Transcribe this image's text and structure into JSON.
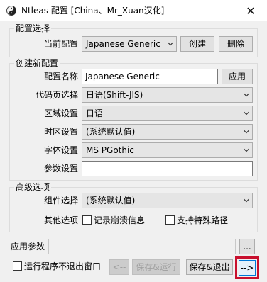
{
  "window": {
    "title": "Ntleas 配置 [China、Mr_Xuan汉化]",
    "close_glyph": "✕"
  },
  "config_select": {
    "group_label": "配置选择",
    "current_label": "当前配置",
    "current_value": "Japanese Generic",
    "create_button": "创建",
    "delete_button": "删除"
  },
  "create_config": {
    "group_label": "创建新配置",
    "name_label": "配置名称",
    "name_value": "Japanese Generic",
    "apply_button": "应用",
    "codepage_label": "代码页选择",
    "codepage_value": "日语(Shift-JIS)",
    "region_label": "区域设置",
    "region_value": "日语",
    "timezone_label": "时区设置",
    "timezone_value": "(系统默认值)",
    "font_label": "字体设置",
    "font_value": "MS PGothic",
    "params_label": "参数设置",
    "params_value": ""
  },
  "advanced": {
    "group_label": "高级选项",
    "component_label": "组件选择",
    "component_value": "(系统默认值)",
    "other_label": "其他选项",
    "log_crash_label": "记录崩溃信息",
    "special_path_label": "支持特殊路径"
  },
  "bottom": {
    "app_params_label": "应用参数",
    "app_params_value": "",
    "browse_button": "...",
    "keep_running_label": "运行程序不退出窗口",
    "back_button": "<--",
    "save_run_button": "保存&运行",
    "save_exit_button": "保存&退出",
    "next_button": "-->"
  },
  "colors": {
    "highlight": "#c8102e",
    "dialog_bg": "#f0f0f0"
  }
}
